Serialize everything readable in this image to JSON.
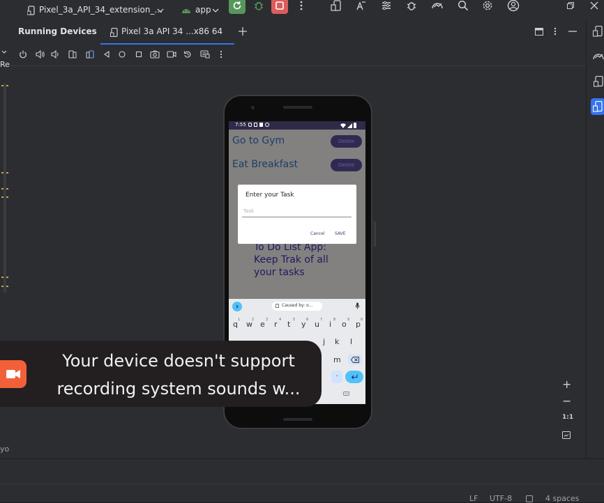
{
  "toolbar": {
    "device_selector": "Pixel_3a_API_34_extension_...",
    "run_config": "app"
  },
  "running_devices": {
    "title": "Running Devices",
    "tab_label": "Pixel 3a API 34 ...x86 64"
  },
  "phone": {
    "status_time": "7:55",
    "tasks": [
      {
        "text": "Go to Gym",
        "delete_label": "Delete"
      },
      {
        "text": "Eat Breakfast",
        "delete_label": "Delete"
      }
    ],
    "background_text": [
      "To Do List App:",
      "Keep Trak of all",
      "your tasks"
    ],
    "dialog": {
      "title": "Enter your Task",
      "placeholder": "Task",
      "cancel_label": "Cancel",
      "save_label": "SAVE"
    },
    "keyboard": {
      "suggestion": "Caused by: o...",
      "row1": [
        "q",
        "w",
        "e",
        "r",
        "t",
        "y",
        "u",
        "i",
        "o",
        "p"
      ],
      "row1_hints": [
        "1",
        "2",
        "3",
        "4",
        "5",
        "6",
        "7",
        "8",
        "9",
        "0"
      ],
      "row2_visible": [
        "j",
        "k",
        "l"
      ],
      "row3_visible": [
        "m"
      ],
      "period": "."
    }
  },
  "toast": {
    "line1": "Your device doesn't support",
    "line2": "recording system sounds w..."
  },
  "zoom": {
    "plus": "+",
    "minus": "−",
    "actual": "1:1"
  },
  "left_strip": {
    "label_top": "Re",
    "label_bottom": "yo"
  },
  "status_bar": {
    "line_sep": "LF",
    "encoding": "UTF-8",
    "indent": "4 spaces"
  },
  "colors": {
    "ide_bg": "#2b2d30",
    "accent": "#3574f0",
    "run_green": "#57965c",
    "stop_red": "#db5c5c",
    "toast_icon": "#f2603a"
  }
}
